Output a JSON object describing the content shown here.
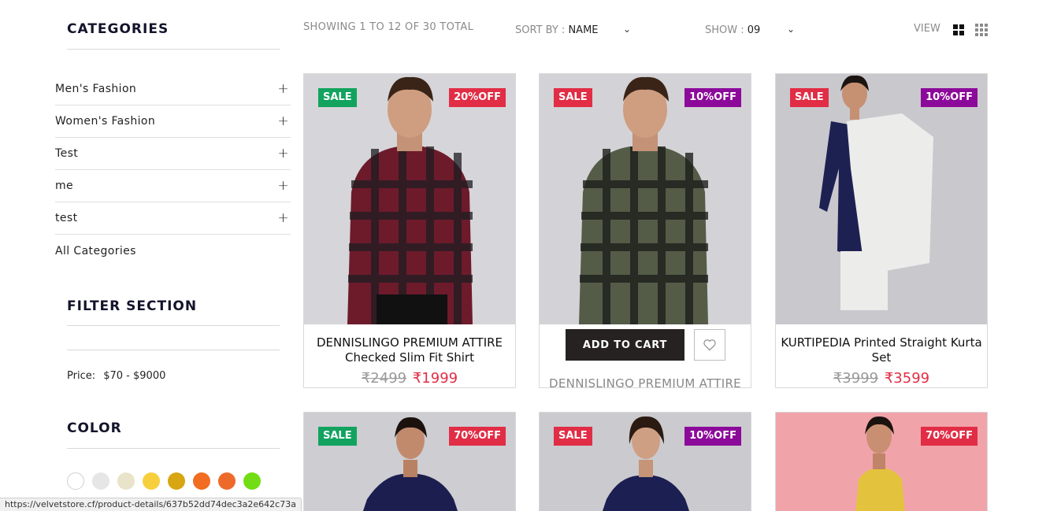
{
  "sidebar": {
    "categories_title": "CATEGORIES",
    "categories": [
      {
        "label": "Men's Fashion",
        "expand": "+"
      },
      {
        "label": "Women's Fashion",
        "expand": "+"
      },
      {
        "label": "Test",
        "expand": "+"
      },
      {
        "label": "me",
        "expand": "+"
      },
      {
        "label": "test",
        "expand": "+"
      },
      {
        "label": "All Categories",
        "expand": ""
      }
    ],
    "filter_title": "FILTER SECTION",
    "price_label": "Price:",
    "price_range": "$70 - $9000",
    "color_title": "COLOR",
    "colors": [
      "#ffffff",
      "#e6e6e6",
      "#e9e3c9",
      "#f7cf3c",
      "#d8a612",
      "#f26d22",
      "#ee6a2a",
      "#72dd14"
    ]
  },
  "toolbar": {
    "showing": "SHOWING 1 TO 12 OF 30 TOTAL",
    "sort_label": "SORT BY :",
    "sort_value": "NAME",
    "show_label": "SHOW :",
    "show_value": "09",
    "view_label": "VIEW"
  },
  "products": [
    {
      "sale": "SALE",
      "off": "20%OFF",
      "title": "DENNISLINGO PREMIUM ATTIRE Checked Slim Fit Shirt",
      "old_price": "₹2499",
      "new_price": "₹1999"
    },
    {
      "sale": "SALE",
      "off": "10%OFF",
      "add_to_cart": "ADD TO CART",
      "title": "DENNISLINGO PREMIUM ATTIRE"
    },
    {
      "sale": "SALE",
      "off": "10%OFF",
      "title": "KURTIPEDIA Printed Straight Kurta Set",
      "old_price": "₹3999",
      "new_price": "₹3599"
    },
    {
      "sale": "SALE",
      "off": "70%OFF"
    },
    {
      "sale": "SALE",
      "off": "10%OFF"
    },
    {
      "off": "70%OFF"
    }
  ],
  "status_bar": {
    "url": "https://velvetstore.cf/product-details/637b52dd74dec3a2e642c73a"
  }
}
